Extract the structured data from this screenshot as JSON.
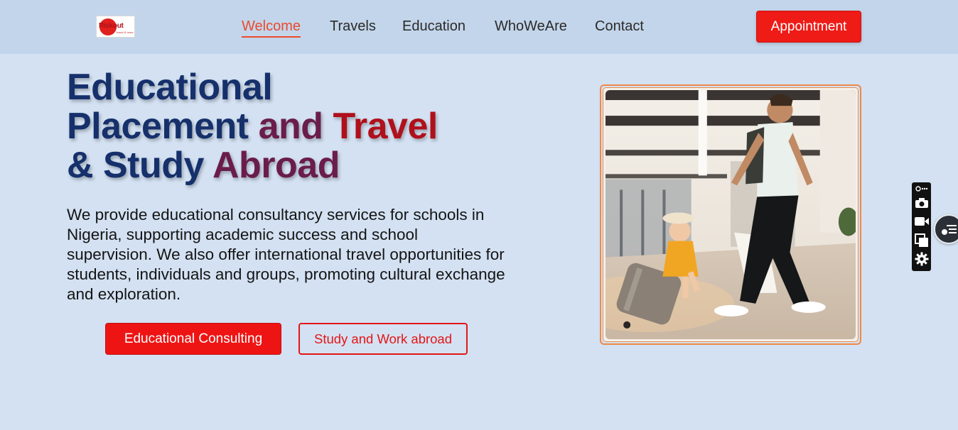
{
  "header": {
    "logo": {
      "text": "Riskout",
      "subtext": "travel & more"
    },
    "nav": [
      {
        "label": "Welcome",
        "active": true
      },
      {
        "label": "Travels",
        "active": false
      },
      {
        "label": "Education",
        "active": false
      },
      {
        "label": "WhoWeAre",
        "active": false
      },
      {
        "label": "Contact",
        "active": false
      }
    ],
    "appointment_label": "Appointment"
  },
  "hero": {
    "headline": {
      "line1": "Educational",
      "line2_a": "Placement",
      "line2_b": "and",
      "line2_c": "Travel",
      "line3_a": "& Study",
      "line3_b": "Abroad"
    },
    "intro": "We provide educational consultancy services for schools in Nigeria, supporting academic success and school supervision. We also offer international travel opportunities for students, individuals and groups, promoting cultural exchange and exploration.",
    "primary_button": "Educational Consulting",
    "secondary_button": "Study and Work abroad"
  },
  "toolbar": {
    "icons": [
      "link-more-icon",
      "camera-icon",
      "video-icon",
      "copy-icon",
      "gear-icon"
    ]
  },
  "colors": {
    "page_bg": "#d3e1f2",
    "header_bg": "#c3d5ea",
    "accent_red": "#ee1b16",
    "nav_active": "#e94b2e",
    "headline_navy": "#15306b",
    "headline_red": "#b0101c",
    "photo_border": "#ef8a48"
  }
}
